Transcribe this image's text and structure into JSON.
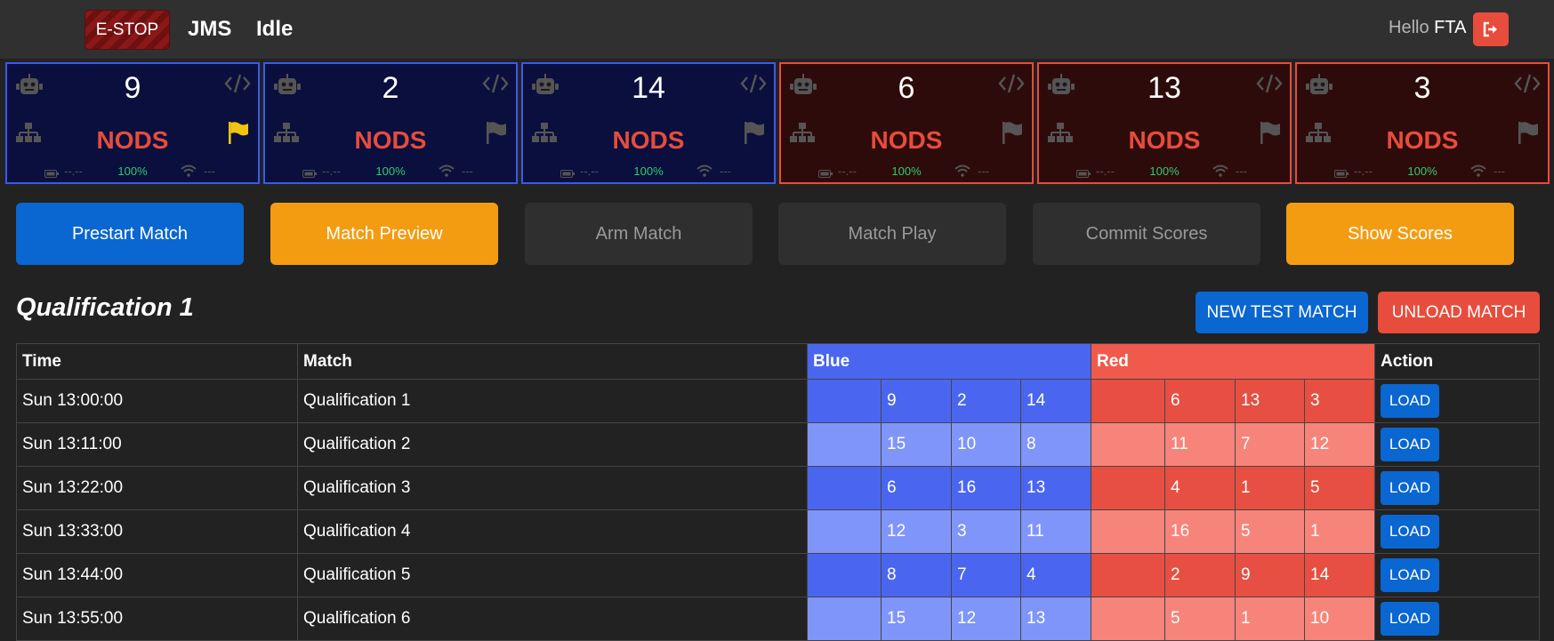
{
  "header": {
    "estop_label": "E-STOP",
    "brand": "JMS",
    "state": "Idle",
    "greeting": "Hello",
    "user": "FTA"
  },
  "stations": [
    {
      "alliance": "blue",
      "team": "9",
      "status": "NODS",
      "flag_active": true,
      "voltage": "--.--",
      "battery": "100%",
      "signal": "---"
    },
    {
      "alliance": "blue",
      "team": "2",
      "status": "NODS",
      "flag_active": false,
      "voltage": "--.--",
      "battery": "100%",
      "signal": "---"
    },
    {
      "alliance": "blue",
      "team": "14",
      "status": "NODS",
      "flag_active": false,
      "voltage": "--.--",
      "battery": "100%",
      "signal": "---"
    },
    {
      "alliance": "red",
      "team": "6",
      "status": "NODS",
      "flag_active": false,
      "voltage": "--.--",
      "battery": "100%",
      "signal": "---"
    },
    {
      "alliance": "red",
      "team": "13",
      "status": "NODS",
      "flag_active": false,
      "voltage": "--.--",
      "battery": "100%",
      "signal": "---"
    },
    {
      "alliance": "red",
      "team": "3",
      "status": "NODS",
      "flag_active": false,
      "voltage": "--.--",
      "battery": "100%",
      "signal": "---"
    }
  ],
  "controls": [
    {
      "label": "Prestart Match",
      "style": "primary"
    },
    {
      "label": "Match Preview",
      "style": "warning"
    },
    {
      "label": "Arm Match",
      "style": "disabled"
    },
    {
      "label": "Match Play",
      "style": "disabled"
    },
    {
      "label": "Commit Scores",
      "style": "disabled"
    },
    {
      "label": "Show Scores",
      "style": "warning"
    }
  ],
  "match": {
    "title": "Qualification 1",
    "new_test_label": "NEW TEST MATCH",
    "unload_label": "UNLOAD MATCH"
  },
  "schedule": {
    "headers": {
      "time": "Time",
      "match": "Match",
      "blue": "Blue",
      "red": "Red",
      "action": "Action"
    },
    "load_label": "LOAD",
    "rows": [
      {
        "time": "Sun 13:00:00",
        "name": "Qualification 1",
        "blue": [
          "9",
          "2",
          "14"
        ],
        "red": [
          "6",
          "13",
          "3"
        ]
      },
      {
        "time": "Sun 13:11:00",
        "name": "Qualification 2",
        "blue": [
          "15",
          "10",
          "8"
        ],
        "red": [
          "11",
          "7",
          "12"
        ]
      },
      {
        "time": "Sun 13:22:00",
        "name": "Qualification 3",
        "blue": [
          "6",
          "16",
          "13"
        ],
        "red": [
          "4",
          "1",
          "5"
        ]
      },
      {
        "time": "Sun 13:33:00",
        "name": "Qualification 4",
        "blue": [
          "12",
          "3",
          "11"
        ],
        "red": [
          "16",
          "5",
          "1"
        ]
      },
      {
        "time": "Sun 13:44:00",
        "name": "Qualification 5",
        "blue": [
          "8",
          "7",
          "4"
        ],
        "red": [
          "2",
          "9",
          "14"
        ]
      },
      {
        "time": "Sun 13:55:00",
        "name": "Qualification 6",
        "blue": [
          "15",
          "12",
          "13"
        ],
        "red": [
          "5",
          "1",
          "10"
        ]
      }
    ]
  },
  "colors": {
    "blue_alliance": "#4a66f0",
    "red_alliance": "#f05a4c",
    "primary": "#0a66d0",
    "warning": "#f39c12",
    "danger": "#e74c3c",
    "flag_active": "#f1c40f"
  }
}
